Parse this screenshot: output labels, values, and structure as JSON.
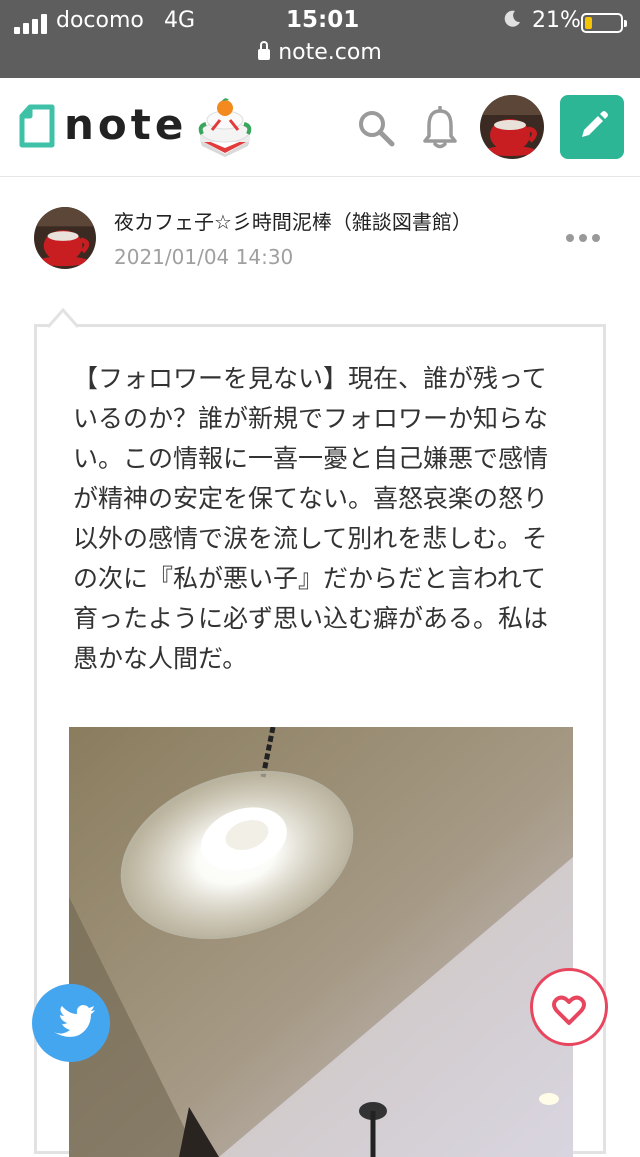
{
  "status_bar": {
    "carrier": "docomo",
    "network": "4G",
    "time": "15:01",
    "battery_percent": "21%",
    "battery_level": 0.21,
    "url": "note.com"
  },
  "header": {
    "logo_text": "note",
    "icons": [
      "note-logo-icon",
      "kagami-mochi-icon",
      "search-icon",
      "bell-icon",
      "user-avatar",
      "pencil-icon"
    ],
    "accent_color": "#2cb696"
  },
  "post": {
    "author_name": "夜カフェ子☆彡時間泥棒（雑談図書館）",
    "date": "2021/01/04 14:30",
    "lines": [
      "【フォロワーを見ない】現在、誰が残って",
      "いるのか？誰が新規でフォロワーか知らな",
      "い。この情報に一喜一憂と自己嫌悪で感情",
      "が精神の安定を保てない。喜怒哀楽の怒り",
      "以外の感情で涙を流して別れを悲しむ。そ",
      "の次に『私が悪い子』だからだと言われて",
      "育ったように必ず思い込む癖がある。私は",
      "愚かな人間だ。"
    ]
  },
  "share": {
    "twitter_color": "#45a6f0",
    "like_color": "#e8455e"
  }
}
